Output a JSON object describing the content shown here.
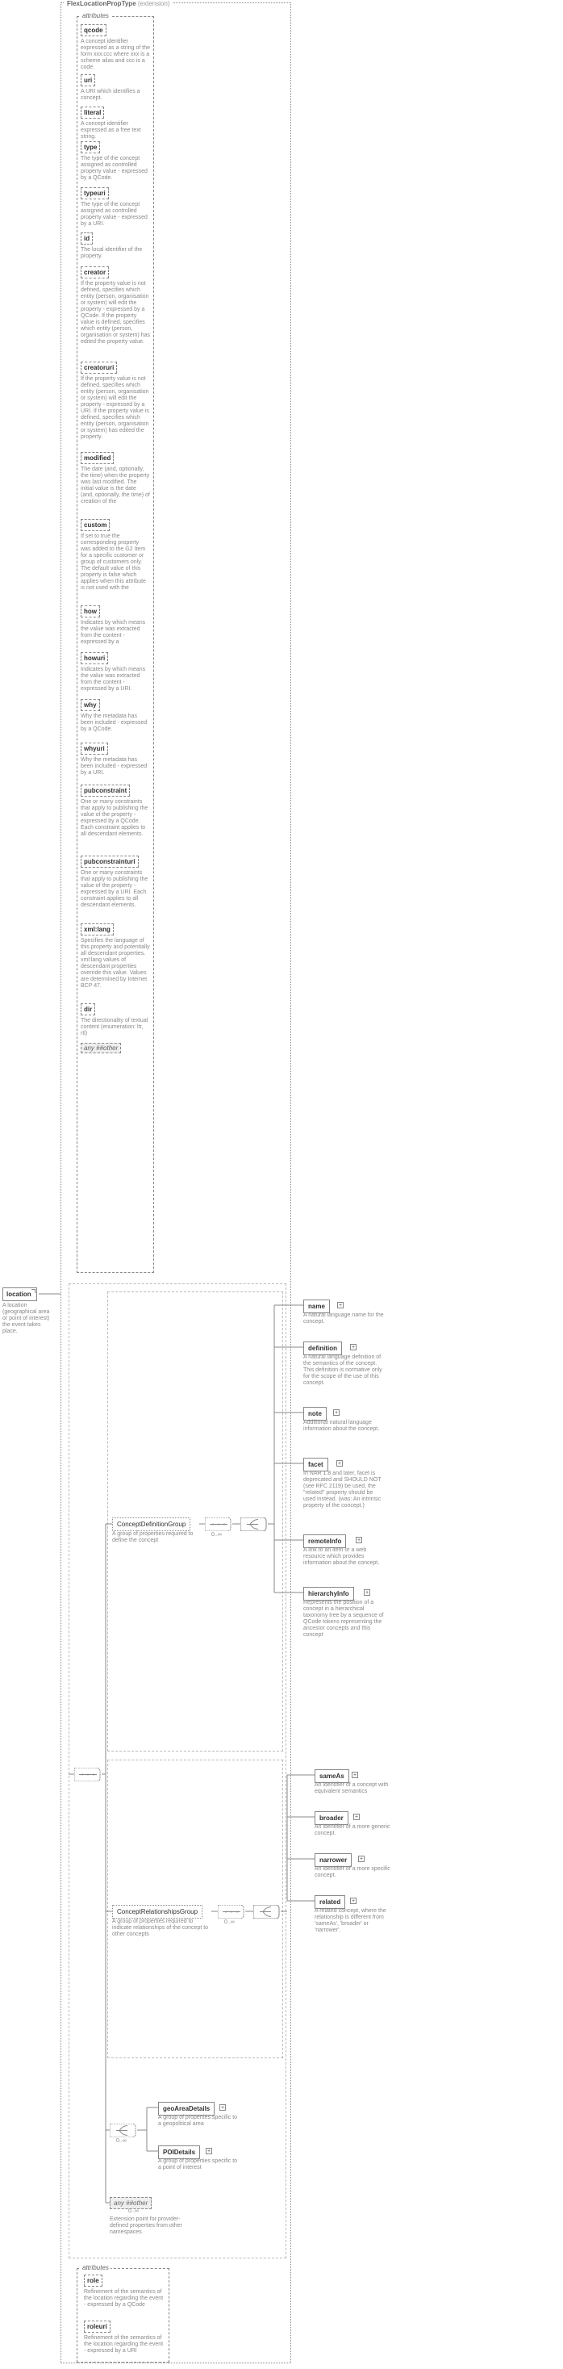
{
  "outer": {
    "title": "FlexLocationPropType",
    "ext": "(extension)"
  },
  "attributes_label": "attributes",
  "attrs": [
    {
      "name": "qcode",
      "note": "A concept identifier expressed as a string of the form xxx:ccc where xxx is a scheme alias and ccc is a code."
    },
    {
      "name": "uri",
      "note": "A URI which identifies a concept."
    },
    {
      "name": "literal",
      "note": "A concept identifier expressed as a free text string."
    },
    {
      "name": "type",
      "note": "The type of the concept assigned as controlled property value - expressed by a QCode."
    },
    {
      "name": "typeuri",
      "note": "The type of the concept assigned as controlled property value - expressed by a URI."
    },
    {
      "name": "id",
      "note": "The local identifier of the property."
    },
    {
      "name": "creator",
      "note": "If the property value is not defined, specifies which entity (person, organisation or system) will edit the property - expressed by a QCode. If the property value is defined, specifies which entity (person, organisation or system) has edited the property value."
    },
    {
      "name": "creatoruri",
      "note": "If the property value is not defined, specifies which entity (person, organisation or system) will edit the property - expressed by a URI. If the property value is defined, specifies which entity (person, organisation or system) has edited the property."
    },
    {
      "name": "modified",
      "note": "The date (and, optionally, the time) when the property was last modified. The initial value is the date (and, optionally, the time) of creation of the"
    },
    {
      "name": "custom",
      "note": "If set to true the corresponding property was added to the G2 Item for a specific customer or group of customers only. The default value of this property is false which applies when this attribute is not used with the"
    },
    {
      "name": "how",
      "note": "Indicates by which means the value was extracted from the content - expressed by a"
    },
    {
      "name": "howuri",
      "note": "Indicates by which means the value was extracted from the content - expressed by a URI."
    },
    {
      "name": "why",
      "note": "Why the metadata has been included - expressed by a QCode."
    },
    {
      "name": "whyuri",
      "note": "Why the metadata has been included - expressed by a URI."
    },
    {
      "name": "pubconstraint",
      "note": "One or many constraints that apply to publishing the value of the property - expressed by a QCode. Each constraint applies to all descendant elements."
    },
    {
      "name": "pubconstrainturi",
      "note": "One or many constraints that apply to publishing the value of the property - expressed by a URI. Each constraint applies to all descendant elements."
    },
    {
      "name": "xml:lang",
      "note": "Specifies the language of this property and potentially all descendant properties. xml:lang values of descendant properties override this value. Values are determined by Internet BCP 47."
    },
    {
      "name": "dir",
      "note": "The directionality of textual content (enumeration: ltr, rtl)"
    }
  ],
  "any_other": "any ##other",
  "root_attrs2": [
    {
      "name": "role",
      "note": "Refinement of the semantics of the location regarding the event - expressed by a QCode"
    },
    {
      "name": "roleuri",
      "note": "Refinement of the semantics of the location regarding the event - expressed by a URI"
    }
  ],
  "root": {
    "name": "location",
    "note": "A location (geographical area or point of interest) the event takes place."
  },
  "cdg": {
    "name": "ConceptDefinitionGroup",
    "note": "A group of properties required to define the concept"
  },
  "crg": {
    "name": "ConceptRelationshipsGroup",
    "note": "A group of properties required to indicate relationships of the concept to other concepts"
  },
  "cdg_leaves": [
    {
      "name": "name",
      "note": "A natural language name for the concept."
    },
    {
      "name": "definition",
      "note": "A natural language definition of the semantics of the concept. This definition is normative only for the scope of the use of this concept."
    },
    {
      "name": "note",
      "note": "Additional natural language information about the concept."
    },
    {
      "name": "facet",
      "note": "In NAR 1.8 and later, facet is deprecated and SHOULD NOT (see RFC 2119) be used, the \"related\" property should be used instead. (was: An intrinsic property of the concept.)"
    },
    {
      "name": "remoteInfo",
      "note": "A link to an item or a web resource which provides information about the concept."
    },
    {
      "name": "hierarchyInfo",
      "note": "Represents the position of a concept in a hierarchical taxonomy tree by a sequence of QCode tokens representing the ancestor concepts and this concept"
    }
  ],
  "crg_leaves": [
    {
      "name": "sameAs",
      "note": "An identifier of a concept with equivalent semantics"
    },
    {
      "name": "broader",
      "note": "An identifier of a more generic concept."
    },
    {
      "name": "narrower",
      "note": "An identifier of a more specific concept."
    },
    {
      "name": "related",
      "note": "A related concept, where the relationship is different from 'sameAs', 'broader' or 'narrower'."
    }
  ],
  "geo": {
    "name": "geoAreaDetails",
    "note": "A group of properties specific to a geopolitical area"
  },
  "poi": {
    "name": "POIDetails",
    "note": "A group of properties specific to a point of interest"
  },
  "any": {
    "label": "any ##other",
    "range": "0..∞",
    "note": "Extension point for provider-defined properties from other namespaces"
  },
  "ranges": {
    "zero_inf": "0..∞"
  }
}
